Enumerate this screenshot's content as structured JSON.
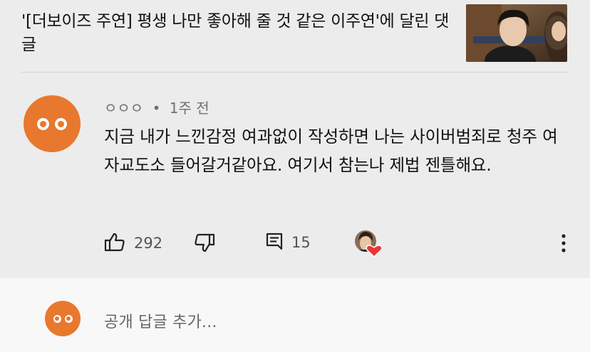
{
  "video": {
    "title": "'[더보이즈 주연] 평생 나만 좋아해 줄 것 같은 이주연'에 달린 댓글"
  },
  "comment": {
    "author": "ㅇㅇㅇ",
    "separator": "•",
    "time": "1주 전",
    "text": "지금 내가 느낀감정 여과없이 작성하면 나는 사이버범죄로 청주 여자교도소 들어갈거같아요. 여기서 참는나 제법 젠틀해요.",
    "like_count": "292",
    "reply_count": "15"
  },
  "reply": {
    "placeholder": "공개 답글 추가..."
  },
  "colors": {
    "avatar": "#e8782e",
    "heart": "#e53935"
  },
  "icons": [
    "thumbs-up-icon",
    "thumbs-down-icon",
    "comment-icon",
    "creator-heart-icon",
    "more-vert-icon"
  ]
}
